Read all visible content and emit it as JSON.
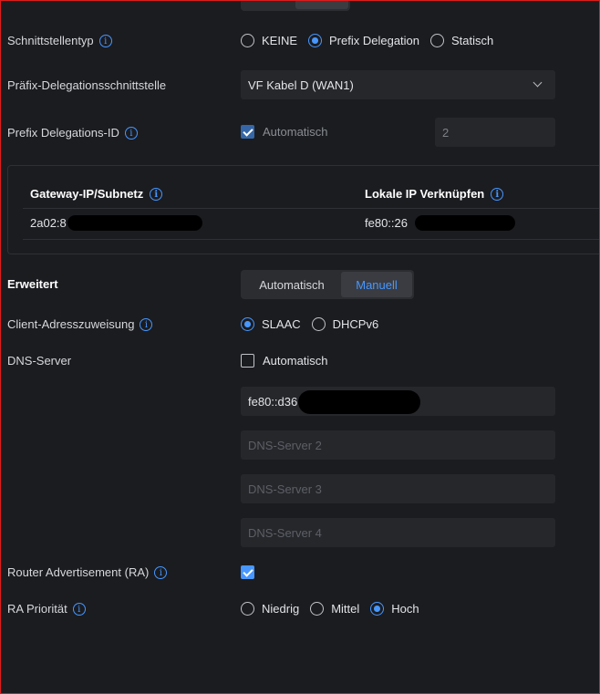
{
  "interface_type": {
    "label": "Schnittstellentyp",
    "options": [
      {
        "label": "KEINE",
        "checked": false
      },
      {
        "label": "Prefix Delegation",
        "checked": true
      },
      {
        "label": "Statisch",
        "checked": false
      }
    ]
  },
  "prefix_delegation_interface": {
    "label": "Präfix-Delegationsschnittstelle",
    "value": "VF Kabel D (WAN1)"
  },
  "prefix_delegation_id": {
    "label": "Prefix Delegations-ID",
    "auto_label": "Automatisch",
    "auto_checked": true,
    "value": "2"
  },
  "table": {
    "col1_header": "Gateway-IP/Subnetz",
    "col2_header": "Lokale IP Verknüpfen",
    "col1_value": "2a02:8",
    "col2_value": "fe80::26"
  },
  "advanced": {
    "label": "Erweitert",
    "options": [
      {
        "label": "Automatisch",
        "active": false
      },
      {
        "label": "Manuell",
        "active": true
      }
    ]
  },
  "client_address": {
    "label": "Client-Adresszuweisung",
    "options": [
      {
        "label": "SLAAC",
        "checked": true
      },
      {
        "label": "DHCPv6",
        "checked": false
      }
    ]
  },
  "dns": {
    "label": "DNS-Server",
    "auto_label": "Automatisch",
    "auto_checked": false,
    "server1": "fe80::d36",
    "server2_placeholder": "DNS-Server 2",
    "server3_placeholder": "DNS-Server 3",
    "server4_placeholder": "DNS-Server 4"
  },
  "router_advertisement": {
    "label": "Router Advertisement (RA)",
    "checked": true
  },
  "ra_priority": {
    "label": "RA Priorität",
    "options": [
      {
        "label": "Niedrig",
        "checked": false
      },
      {
        "label": "Mittel",
        "checked": false
      },
      {
        "label": "Hoch",
        "checked": true
      }
    ]
  },
  "colors": {
    "accent": "#4797ff",
    "background": "#1b1c20",
    "field": "#26272b",
    "frame": "#e01b1b"
  }
}
